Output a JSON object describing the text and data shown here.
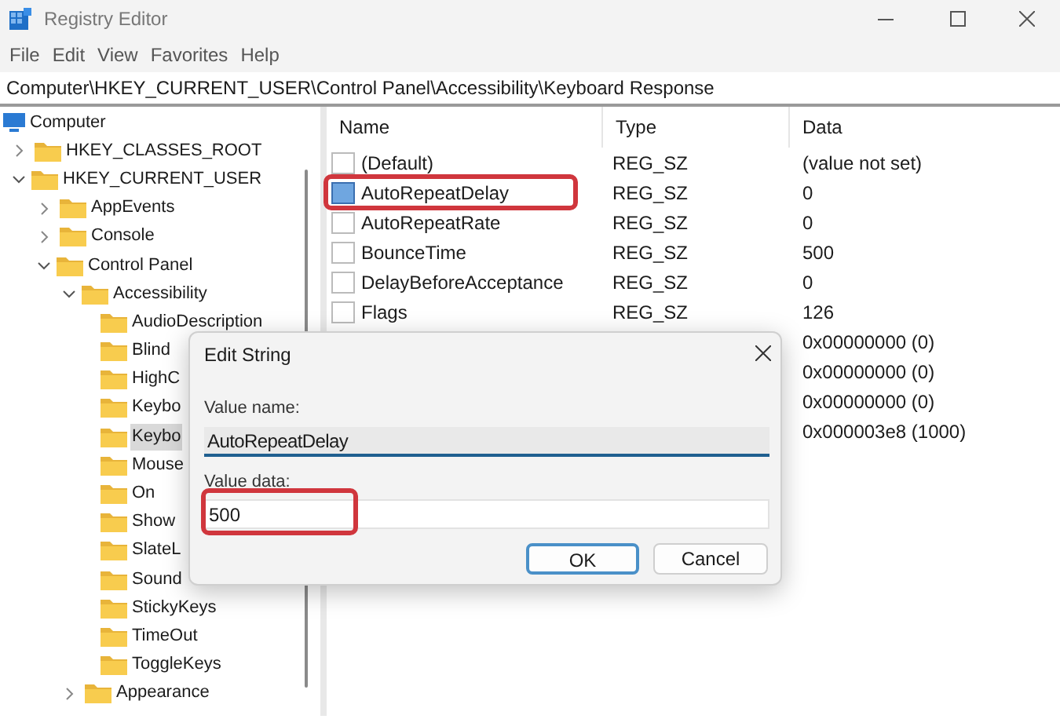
{
  "window": {
    "title": "Registry Editor"
  },
  "menu": [
    "File",
    "Edit",
    "View",
    "Favorites",
    "Help"
  ],
  "address": "Computer\\HKEY_CURRENT_USER\\Control Panel\\Accessibility\\Keyboard Response",
  "tree": {
    "label": "Computer",
    "selected": false,
    "children": [
      {
        "label": "HKEY_CLASSES_ROOT",
        "expanded": false,
        "selected": false
      },
      {
        "label": "HKEY_CURRENT_USER",
        "expanded": true,
        "selected": false,
        "children": [
          {
            "label": "AppEvents",
            "expanded": false,
            "selected": false
          },
          {
            "label": "Console",
            "expanded": false,
            "selected": false
          },
          {
            "label": "Control Panel",
            "expanded": true,
            "selected": false,
            "children": [
              {
                "label": "Accessibility",
                "expanded": true,
                "selected": false,
                "children": [
                  {
                    "label": "AudioDescription",
                    "selected": false
                  },
                  {
                    "label": "Blind",
                    "selected": false
                  },
                  {
                    "label": "HighC",
                    "selected": false
                  },
                  {
                    "label": "Keybo",
                    "selected": false
                  },
                  {
                    "label": "Keybo",
                    "selected": true
                  },
                  {
                    "label": "Mouse",
                    "selected": false
                  },
                  {
                    "label": "On",
                    "selected": false
                  },
                  {
                    "label": "Show",
                    "selected": false
                  },
                  {
                    "label": "SlateL",
                    "selected": false
                  },
                  {
                    "label": "Sound",
                    "selected": false
                  },
                  {
                    "label": "StickyKeys",
                    "selected": false
                  },
                  {
                    "label": "TimeOut",
                    "selected": false
                  },
                  {
                    "label": "ToggleKeys",
                    "selected": false
                  }
                ]
              },
              {
                "label": "Appearance",
                "expanded": false,
                "selected": false
              }
            ]
          }
        ]
      }
    ]
  },
  "values": {
    "columns": [
      "Name",
      "Type",
      "Data"
    ],
    "rows": [
      {
        "name": "(Default)",
        "type": "REG_SZ",
        "data": "(value not set)",
        "selected": false,
        "highlighted": false
      },
      {
        "name": "AutoRepeatDelay",
        "type": "REG_SZ",
        "data": "0",
        "selected": true,
        "highlighted": true
      },
      {
        "name": "AutoRepeatRate",
        "type": "REG_SZ",
        "data": "0",
        "selected": false,
        "highlighted": false
      },
      {
        "name": "BounceTime",
        "type": "REG_SZ",
        "data": "500",
        "selected": false,
        "highlighted": false
      },
      {
        "name": "DelayBeforeAcceptance",
        "type": "REG_SZ",
        "data": "0",
        "selected": false,
        "highlighted": false
      },
      {
        "name": "Flags",
        "type": "REG_SZ",
        "data": "126",
        "selected": false,
        "highlighted": false
      },
      {
        "data": "0x00000000 (0)"
      },
      {
        "data": "0x00000000 (0)"
      },
      {
        "data": "0x00000000 (0)"
      },
      {
        "data": "0x000003e8 (1000)"
      }
    ]
  },
  "dialog": {
    "title": "Edit String",
    "value_name_label": "Value name:",
    "value_name": "AutoRepeatDelay",
    "value_data_label": "Value data:",
    "value_data": "500",
    "value_data_highlighted": true,
    "buttons": [
      {
        "label": "OK",
        "default": true
      },
      {
        "label": "Cancel",
        "default": false
      }
    ]
  }
}
